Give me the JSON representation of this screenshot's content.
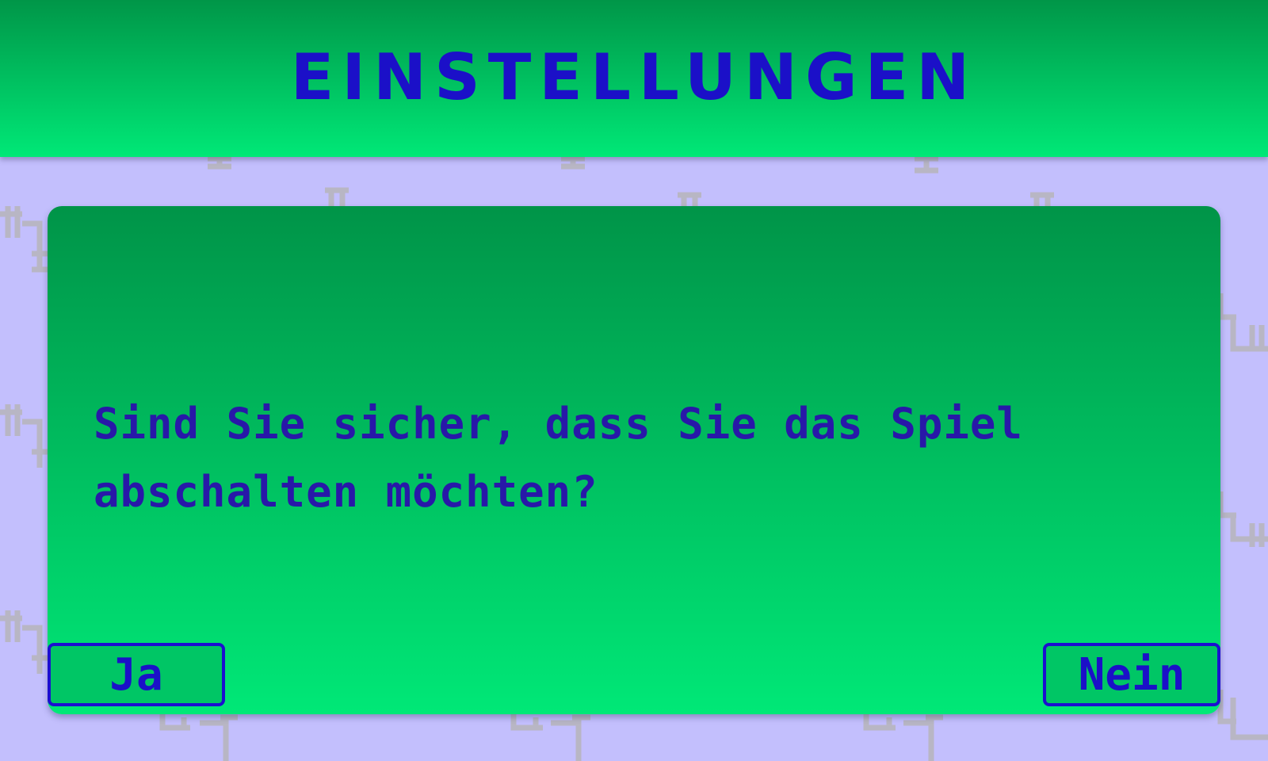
{
  "header": {
    "title": "EINSTELLUNGEN"
  },
  "dialog": {
    "message": "Sind Sie sicher, dass Sie das Spiel abschalten möchten?",
    "yes_label": "Ja",
    "no_label": "Nein"
  },
  "colors": {
    "background": "#c3bffd",
    "header_gradient_top": "#009648",
    "header_gradient_bottom": "#00e877",
    "title_text": "#1b10c8",
    "message_text": "#2818a8",
    "button_border": "#1c0fd0",
    "pattern": "#b8b6c4"
  },
  "icons": {
    "background_pattern": "pipe-circuit-pattern"
  }
}
